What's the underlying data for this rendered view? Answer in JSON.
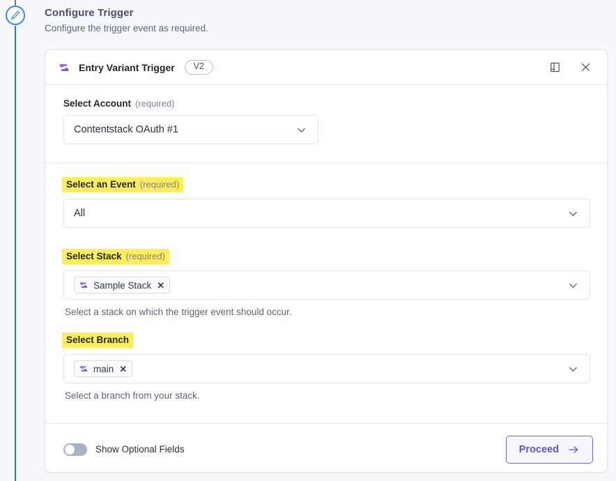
{
  "page": {
    "title": "Configure Trigger",
    "subtitle": "Configure the trigger event as required."
  },
  "rail": {
    "node_icon": "pencil-icon"
  },
  "card": {
    "header": {
      "logo_icon": "contentstack-logo-icon",
      "title": "Entry Variant Trigger",
      "version_badge": "V2",
      "docs_icon": "book-icon",
      "close_icon": "close-icon"
    },
    "account": {
      "label": "Select Account",
      "required_text": "(required)",
      "value": "Contentstack OAuth #1",
      "chevron_icon": "chevron-down-icon"
    },
    "event": {
      "label": "Select an Event",
      "required_text": "(required)",
      "value": "All",
      "highlighted": true,
      "chevron_icon": "chevron-down-icon"
    },
    "stack": {
      "label": "Select Stack",
      "required_text": "(required)",
      "chip_label": "Sample Stack",
      "chip_logo_icon": "contentstack-logo-icon",
      "chip_remove_icon": "close-small-icon",
      "helper": "Select a stack on which the trigger event should occur.",
      "highlighted": true,
      "chevron_icon": "chevron-down-icon"
    },
    "branch": {
      "label": "Select Branch",
      "chip_label": "main",
      "chip_logo_icon": "contentstack-logo-icon",
      "chip_remove_icon": "close-small-icon",
      "helper": "Select a branch from your stack.",
      "highlighted": true,
      "chevron_icon": "chevron-down-icon"
    },
    "footer": {
      "toggle_label": "Show Optional Fields",
      "toggle_on": false,
      "proceed_label": "Proceed",
      "proceed_arrow_icon": "arrow-right-icon"
    }
  },
  "colors": {
    "highlight": "#ffee58",
    "accent_purple": "#5b52dd",
    "rail_blue": "#1f7ae0",
    "page_bg": "#f7f8fb"
  }
}
